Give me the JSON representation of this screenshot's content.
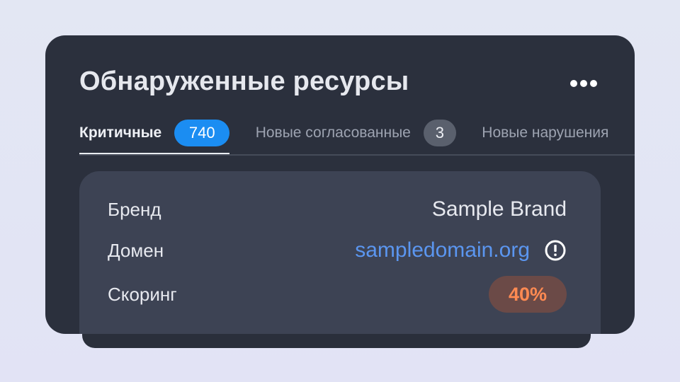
{
  "panel": {
    "title": "Обнаруженные ресурсы",
    "more_icon": "more-horizontal-icon"
  },
  "tabs": [
    {
      "label": "Критичные",
      "count": "740",
      "active": true
    },
    {
      "label": "Новые согласованные",
      "count": "3",
      "active": false
    },
    {
      "label": "Новые нарушения",
      "count": "",
      "active": false
    }
  ],
  "details": {
    "brand_label": "Бренд",
    "brand_value": "Sample Brand",
    "domain_label": "Домен",
    "domain_value": "sampledomain.org",
    "domain_icon": "alert-info-icon",
    "score_label": "Скоринг",
    "score_value": "40%"
  },
  "colors": {
    "background": "#e3e7f3",
    "panel": "#2b303d",
    "card": "#3d4354",
    "accent_blue": "#1b8df2",
    "link": "#5b96f0",
    "score_text": "#ff8a52",
    "score_bg": "#6b4a47"
  }
}
